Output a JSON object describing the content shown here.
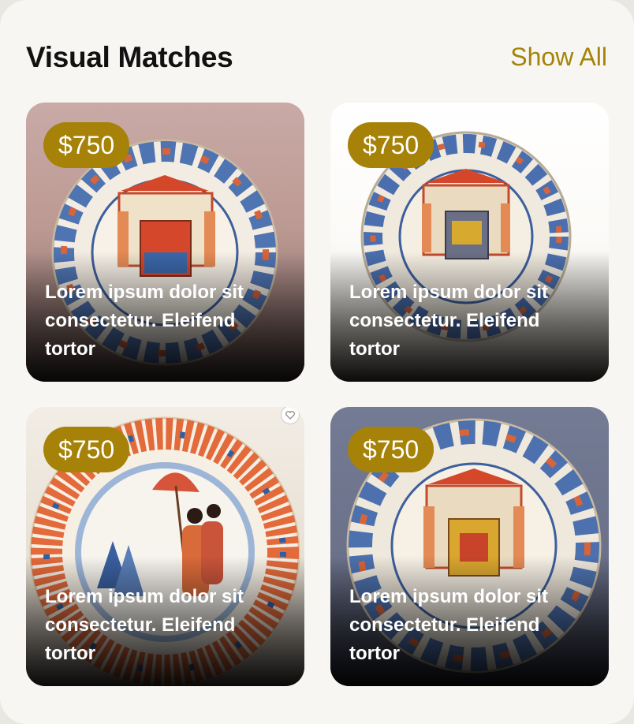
{
  "header": {
    "title": "Visual Matches",
    "show_all": "Show All"
  },
  "cards": [
    {
      "price": "$750",
      "caption": "Lorem ipsum dolor sit consectetur. Eleifend tortor"
    },
    {
      "price": "$750",
      "caption": "Lorem ipsum dolor sit consectetur. Eleifend tortor"
    },
    {
      "price": "$750",
      "caption": "Lorem ipsum dolor sit consectetur. Eleifend tortor"
    },
    {
      "price": "$750",
      "caption": "Lorem ipsum dolor sit consectetur. Eleifend tortor"
    }
  ],
  "colors": {
    "accent": "#a68208",
    "show_all": "#a48408",
    "background": "#f8f6f2"
  }
}
